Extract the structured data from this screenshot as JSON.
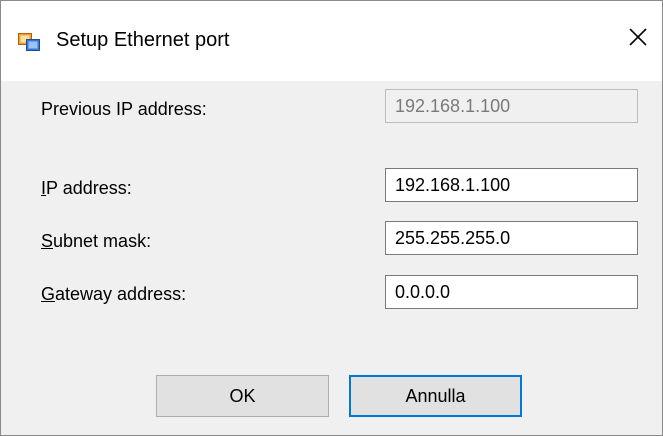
{
  "window": {
    "title": "Setup Ethernet port",
    "app_icon": "network-port-icon",
    "close_icon": "close-icon"
  },
  "fields": {
    "previous_ip": {
      "label": "Previous IP address:",
      "value": "192.168.1.100",
      "readonly": true
    },
    "ip": {
      "label_mnemonic": "I",
      "label_rest": "P address:",
      "value": "192.168.1.100"
    },
    "subnet": {
      "label_mnemonic": "S",
      "label_rest": "ubnet mask:",
      "value": "255.255.255.0"
    },
    "gateway": {
      "label_mnemonic": "G",
      "label_rest": "ateway address:",
      "value": "0.0.0.0"
    }
  },
  "buttons": {
    "ok": "OK",
    "cancel": "Annulla"
  },
  "colors": {
    "accent": "#0078d7",
    "dialog_background": "#f0f0f0"
  }
}
